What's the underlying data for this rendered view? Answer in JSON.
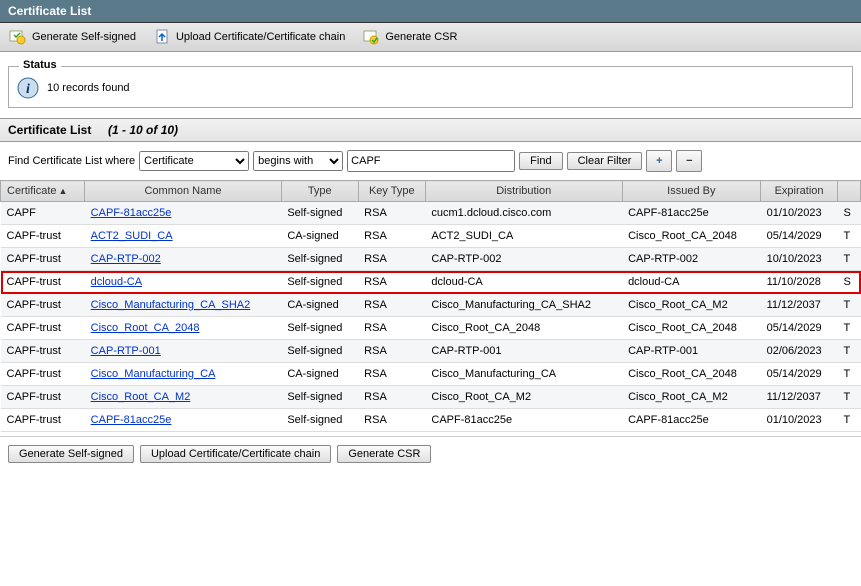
{
  "window": {
    "title": "Certificate List"
  },
  "toolbar": {
    "gen_self": "Generate Self-signed",
    "upload": "Upload Certificate/Certificate chain",
    "gen_csr": "Generate CSR"
  },
  "status": {
    "legend": "Status",
    "message": "10 records found"
  },
  "section": {
    "title": "Certificate List",
    "range": "(1 - 10 of 10)"
  },
  "filter": {
    "prefix": "Find Certificate List where",
    "field_options": [
      "Certificate"
    ],
    "field_selected": "Certificate",
    "op_options": [
      "begins with"
    ],
    "op_selected": "begins with",
    "value": "CAPF",
    "find": "Find",
    "clear": "Clear Filter"
  },
  "columns": [
    "Certificate",
    "Common Name",
    "Type",
    "Key Type",
    "Distribution",
    "Issued By",
    "Expiration",
    ""
  ],
  "sort_col": 0,
  "rows": [
    {
      "cert": "CAPF",
      "cn": "CAPF-81acc25e",
      "type": "Self-signed",
      "key": "RSA",
      "dist": "cucm1.dcloud.cisco.com",
      "issuer": "CAPF-81acc25e",
      "exp": "01/10/2023",
      "tail": "S",
      "hl": false
    },
    {
      "cert": "CAPF-trust",
      "cn": "ACT2_SUDI_CA",
      "type": "CA-signed",
      "key": "RSA",
      "dist": "ACT2_SUDI_CA",
      "issuer": "Cisco_Root_CA_2048",
      "exp": "05/14/2029",
      "tail": "T",
      "hl": false
    },
    {
      "cert": "CAPF-trust",
      "cn": "CAP-RTP-002",
      "type": "Self-signed",
      "key": "RSA",
      "dist": "CAP-RTP-002",
      "issuer": "CAP-RTP-002",
      "exp": "10/10/2023",
      "tail": "T",
      "hl": false
    },
    {
      "cert": "CAPF-trust",
      "cn": "dcloud-CA",
      "type": "Self-signed",
      "key": "RSA",
      "dist": "dcloud-CA",
      "issuer": "dcloud-CA",
      "exp": "11/10/2028",
      "tail": "S",
      "hl": true
    },
    {
      "cert": "CAPF-trust",
      "cn": "Cisco_Manufacturing_CA_SHA2",
      "type": "CA-signed",
      "key": "RSA",
      "dist": "Cisco_Manufacturing_CA_SHA2",
      "issuer": "Cisco_Root_CA_M2",
      "exp": "11/12/2037",
      "tail": "T",
      "hl": false
    },
    {
      "cert": "CAPF-trust",
      "cn": "Cisco_Root_CA_2048",
      "type": "Self-signed",
      "key": "RSA",
      "dist": "Cisco_Root_CA_2048",
      "issuer": "Cisco_Root_CA_2048",
      "exp": "05/14/2029",
      "tail": "T",
      "hl": false
    },
    {
      "cert": "CAPF-trust",
      "cn": "CAP-RTP-001",
      "type": "Self-signed",
      "key": "RSA",
      "dist": "CAP-RTP-001",
      "issuer": "CAP-RTP-001",
      "exp": "02/06/2023",
      "tail": "T",
      "hl": false
    },
    {
      "cert": "CAPF-trust",
      "cn": "Cisco_Manufacturing_CA",
      "type": "CA-signed",
      "key": "RSA",
      "dist": "Cisco_Manufacturing_CA",
      "issuer": "Cisco_Root_CA_2048",
      "exp": "05/14/2029",
      "tail": "T",
      "hl": false
    },
    {
      "cert": "CAPF-trust",
      "cn": "Cisco_Root_CA_M2",
      "type": "Self-signed",
      "key": "RSA",
      "dist": "Cisco_Root_CA_M2",
      "issuer": "Cisco_Root_CA_M2",
      "exp": "11/12/2037",
      "tail": "T",
      "hl": false
    },
    {
      "cert": "CAPF-trust",
      "cn": "CAPF-81acc25e",
      "type": "Self-signed",
      "key": "RSA",
      "dist": "CAPF-81acc25e",
      "issuer": "CAPF-81acc25e",
      "exp": "01/10/2023",
      "tail": "T",
      "hl": false
    }
  ],
  "footer": {
    "gen_self": "Generate Self-signed",
    "upload": "Upload Certificate/Certificate chain",
    "gen_csr": "Generate CSR"
  }
}
